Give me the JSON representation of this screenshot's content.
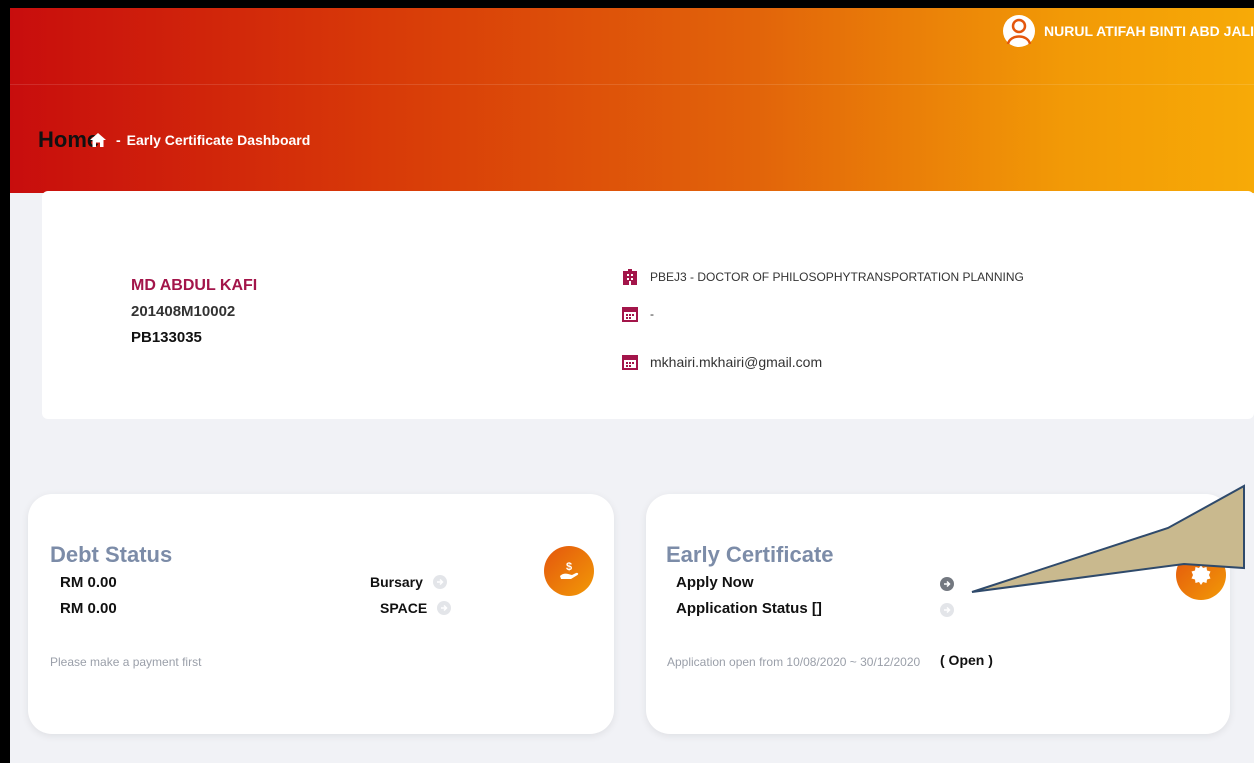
{
  "header": {
    "user_name": "NURUL ATIFAH BINTI ABD JALIL",
    "page_title": "Home",
    "breadcrumb_separator": "-",
    "breadcrumb_current": "Early Certificate Dashboard"
  },
  "profile": {
    "name": "MD ABDUL KAFI",
    "student_id": "201408M10002",
    "code": "PB133035",
    "program": "PBEJ3 - DOCTOR OF PHILOSOPHYTRANSPORTATION PLANNING",
    "date": "-",
    "email": "mkhairi.mkhairi@gmail.com"
  },
  "debt": {
    "title": "Debt Status",
    "rows": [
      {
        "amount": "RM 0.00",
        "label": "Bursary"
      },
      {
        "amount": "RM 0.00",
        "label": "SPACE"
      }
    ],
    "note": "Please make a payment first"
  },
  "early": {
    "title": "Early Certificate",
    "apply_label": "Apply Now",
    "status_label": "Application Status []",
    "note": "Application open from 10/08/2020 ~ 30/12/2020",
    "open_label": "( Open )"
  },
  "icons": {
    "user": "user-outline-icon",
    "home": "home-icon",
    "program": "building-icon",
    "calendar": "calendar-icon",
    "debt": "hand-money-icon",
    "certificate": "badge-icon",
    "arrow": "arrow-circle-icon"
  },
  "colors": {
    "header_start": "#c80d0d",
    "header_end": "#f7aa07",
    "name": "#a3154a",
    "card_title": "#7c8ca8",
    "icon_accent": "#a3154a"
  }
}
